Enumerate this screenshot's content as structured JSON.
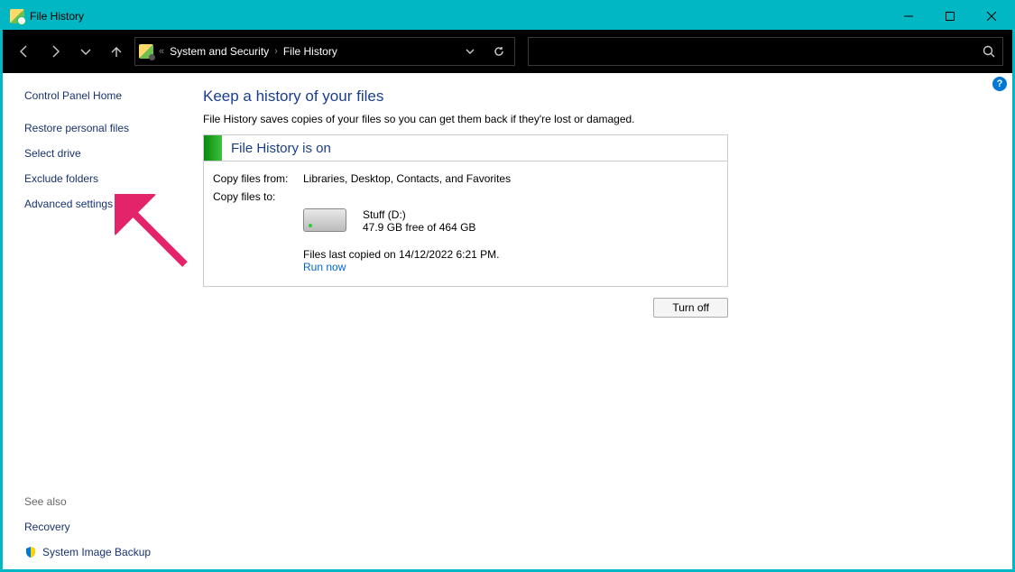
{
  "titlebar": {
    "title": "File History"
  },
  "breadcrumb": {
    "prefix": "«",
    "part1": "System and Security",
    "part2": "File History"
  },
  "sidebar": {
    "home": "Control Panel Home",
    "items": [
      "Restore personal files",
      "Select drive",
      "Exclude folders",
      "Advanced settings"
    ],
    "see_also_label": "See also",
    "see_also": [
      "Recovery",
      "System Image Backup"
    ]
  },
  "content": {
    "heading": "Keep a history of your files",
    "subtext": "File History saves copies of your files so you can get them back if they're lost or damaged.",
    "panel_title": "File History is on",
    "copy_from_label": "Copy files from:",
    "copy_from_value": "Libraries, Desktop, Contacts, and Favorites",
    "copy_to_label": "Copy files to:",
    "drive_name": "Stuff (D:)",
    "drive_free": "47.9 GB free of 464 GB",
    "last_copied": "Files last copied on 14/12/2022 6:21 PM.",
    "run_now": "Run now",
    "turn_off": "Turn off"
  },
  "help_icon": "?"
}
